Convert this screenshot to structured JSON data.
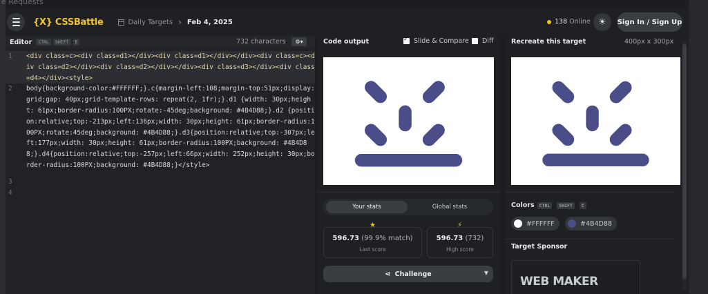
{
  "background": {
    "partial_text": "e Requests"
  },
  "header": {
    "logo": "{X} CSSBattle",
    "breadcrumb": {
      "parent": "Daily Targets",
      "current": "Feb 4, 2025"
    },
    "online_count": "138",
    "online_label": "Online",
    "signin_label": "Sign In / Sign Up"
  },
  "editor": {
    "title": "Editor",
    "keys": [
      "CTRL",
      "SHIFT",
      "E"
    ],
    "char_count": "732 characters",
    "lines": [
      {
        "num": "1",
        "text": "<div class=c><div class=d1></div><div class=d1></div></div><div class=c><div class=d2></div><div class=d2></div></div><div class=d3></div><div class=d4></div><style>"
      },
      {
        "num": "2",
        "text": "body{background-color:#FFFFFF;}.c{margin-left:108;margin-top:51px;display:grid;gap: 40px;grid-template-rows: repeat(2, 1fr);}.d1 {width: 30px;height: 61px;border-radius:100PX;rotate:-45deg;background: #4B4D88;}.d2 {position:relative;top:-213px;left:136px;width: 30px;height: 61px;border-radius:100PX;rotate:45deg;background: #4B4D88;}.d3{position:relative;top:-307px;left:177px;width: 30px;height: 61px;border-radius:100PX;background: #4B4D88;}.d4{position:relative;top:-257px;left:66px;width: 252px;height: 30px;border-radius:100PX;background: #4B4D88;}</style>"
      },
      {
        "num": "3",
        "text": ""
      },
      {
        "num": "4",
        "text": ""
      }
    ]
  },
  "output": {
    "title": "Code output",
    "slide_compare_label": "Slide & Compare",
    "diff_label": "Diff"
  },
  "stats": {
    "tab_your": "Your stats",
    "tab_global": "Global stats",
    "last_score": {
      "value": "596.73",
      "detail": "(99.9% match)",
      "label": "Last score"
    },
    "high_score": {
      "value": "596.73",
      "detail": "(732)",
      "label": "High score"
    },
    "challenge_label": "Challenge"
  },
  "target": {
    "title": "Recreate this target",
    "size": "400px x 300px",
    "colors_label": "Colors",
    "color_keys": [
      "CTRL",
      "SHIFT",
      "C"
    ],
    "colors": [
      {
        "hex": "#FFFFFF"
      },
      {
        "hex": "#4B4D88"
      }
    ],
    "sponsor_label": "Target Sponsor",
    "sponsor_name": "WEB MAKER"
  },
  "icons": {
    "menu": "menu-icon",
    "calendar": "calendar-icon",
    "sun": "sun-icon",
    "gear": "gear-icon",
    "star": "star-icon",
    "bolt": "bolt-icon",
    "share": "share-icon"
  },
  "colors": {
    "accent": "#F5C518",
    "shape": "#4B4D88",
    "canvas": "#FFFFFF"
  }
}
